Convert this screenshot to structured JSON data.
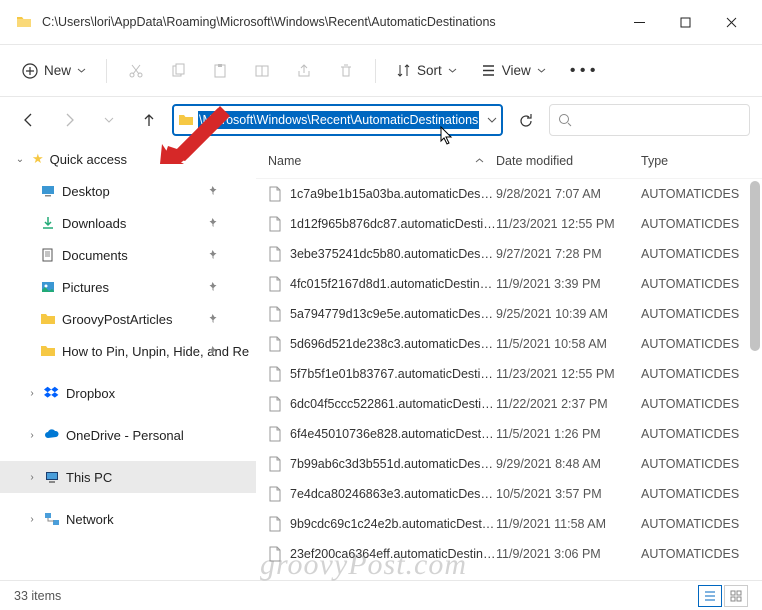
{
  "title": "C:\\Users\\lori\\AppData\\Roaming\\Microsoft\\Windows\\Recent\\AutomaticDestinations",
  "toolbar": {
    "new": "New",
    "sort": "Sort",
    "view": "View"
  },
  "address_selected": "\\Microsoft\\Windows\\Recent\\AutomaticDestinations",
  "columns": {
    "name": "Name",
    "date": "Date modified",
    "type": "Type"
  },
  "sidebar": {
    "quick": "Quick access",
    "items": [
      {
        "label": "Desktop",
        "icon": "desktop"
      },
      {
        "label": "Downloads",
        "icon": "downloads"
      },
      {
        "label": "Documents",
        "icon": "documents"
      },
      {
        "label": "Pictures",
        "icon": "pictures"
      },
      {
        "label": "GroovyPostArticles",
        "icon": "folder"
      },
      {
        "label": "How to Pin, Unpin, Hide, and Re",
        "icon": "folder"
      }
    ],
    "dropbox": "Dropbox",
    "onedrive": "OneDrive - Personal",
    "thispc": "This PC",
    "network": "Network"
  },
  "files": [
    {
      "name": "1c7a9be1b15a03ba.automaticDestinatio...",
      "date": "9/28/2021 7:07 AM",
      "type": "AUTOMATICDES"
    },
    {
      "name": "1d12f965b876dc87.automaticDestinatio...",
      "date": "11/23/2021 12:55 PM",
      "type": "AUTOMATICDES"
    },
    {
      "name": "3ebe375241dc5b80.automaticDestinatio...",
      "date": "9/27/2021 7:28 PM",
      "type": "AUTOMATICDES"
    },
    {
      "name": "4fc015f2167d8d1.automaticDestinations-...",
      "date": "11/9/2021 3:39 PM",
      "type": "AUTOMATICDES"
    },
    {
      "name": "5a794779d13c9e5e.automaticDestinatio...",
      "date": "9/25/2021 10:39 AM",
      "type": "AUTOMATICDES"
    },
    {
      "name": "5d696d521de238c3.automaticDestinatio...",
      "date": "11/5/2021 10:58 AM",
      "type": "AUTOMATICDES"
    },
    {
      "name": "5f7b5f1e01b83767.automaticDestination...",
      "date": "11/23/2021 12:55 PM",
      "type": "AUTOMATICDES"
    },
    {
      "name": "6dc04f5ccc522861.automaticDestination...",
      "date": "11/22/2021 2:37 PM",
      "type": "AUTOMATICDES"
    },
    {
      "name": "6f4e45010736e828.automaticDestinatio...",
      "date": "11/5/2021 1:26 PM",
      "type": "AUTOMATICDES"
    },
    {
      "name": "7b99ab6c3d3b551d.automaticDestinatio...",
      "date": "9/29/2021 8:48 AM",
      "type": "AUTOMATICDES"
    },
    {
      "name": "7e4dca80246863e3.automaticDestinatio...",
      "date": "10/5/2021 3:57 PM",
      "type": "AUTOMATICDES"
    },
    {
      "name": "9b9cdc69c1c24e2b.automaticDestinatio...",
      "date": "11/9/2021 11:58 AM",
      "type": "AUTOMATICDES"
    },
    {
      "name": "23ef200ca6364eff.automaticDestinations-...",
      "date": "11/9/2021 3:06 PM",
      "type": "AUTOMATICDES"
    }
  ],
  "status": "33 items",
  "watermark": "groovyPost.com"
}
